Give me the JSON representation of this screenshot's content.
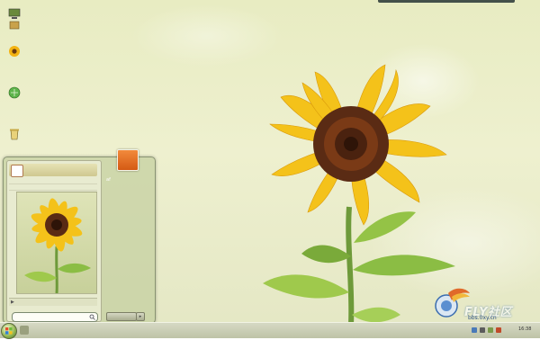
{
  "desktop": {
    "icons": [
      {
        "name": "computer",
        "label": ""
      },
      {
        "name": "user-folder",
        "label": ""
      },
      {
        "name": "sunflower-app",
        "label": ""
      },
      {
        "name": "network",
        "label": ""
      },
      {
        "name": "recycle-bin",
        "label": ""
      }
    ]
  },
  "start_menu": {
    "user_label": "",
    "all_programs_label": "",
    "search_placeholder": "",
    "right_items": [
      {
        "label": "af"
      },
      {
        "label": ""
      },
      {
        "label": ""
      },
      {
        "label": ""
      },
      {
        "label": ""
      },
      {
        "label": ""
      },
      {
        "label": ""
      },
      {
        "label": ""
      },
      {
        "label": ""
      },
      {
        "label": ""
      }
    ],
    "shutdown_label": ""
  },
  "taskbar": {
    "clock_time": "16:38"
  },
  "watermark": {
    "brand": "FLY社区",
    "url": "bbs.0xy.cn"
  },
  "colors": {
    "sky": "#eef0cf",
    "petal": "#f4c21a",
    "center": "#5a2b14",
    "stem": "#6e9a3a",
    "taskbar": "#c9ccb2"
  }
}
